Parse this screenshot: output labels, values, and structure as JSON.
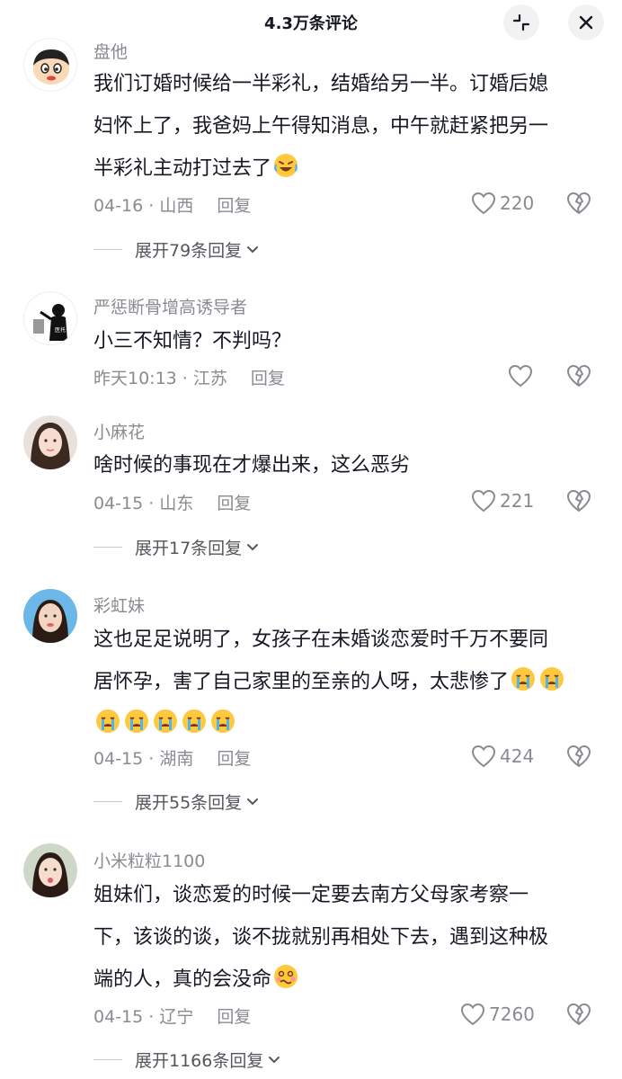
{
  "header": {
    "title": "4.3万条评论",
    "collapse_icon": "collapse-icon",
    "close_icon": "close-icon"
  },
  "comments": [
    {
      "username": "盘他",
      "lines": [
        "我们订婚时候给一半彩礼，结婚给另一半。订婚后媳",
        "妇怀上了，我爸妈上午得知消息，中午就赶紧把另一",
        "半彩礼主动打过去了"
      ],
      "emoji": [
        "laugh-cry-emoji"
      ],
      "date": "04-16",
      "location": "山西",
      "reply_label": "回复",
      "likes": "220",
      "expand": "展开79条回复"
    },
    {
      "username": "严惩断骨增高诱导者",
      "lines": [
        "小三不知情？不判吗？"
      ],
      "date": "昨天10:13",
      "location": "江苏",
      "reply_label": "回复",
      "likes": ""
    },
    {
      "username": "小麻花",
      "lines": [
        "啥时候的事现在才爆出来，这么恶劣"
      ],
      "date": "04-15",
      "location": "山东",
      "reply_label": "回复",
      "likes": "221",
      "expand": "展开17条回复"
    },
    {
      "username": "彩虹妹",
      "lines": [
        "这也足足说明了，女孩子在未婚谈恋爱时千万不要同",
        "居怀孕，害了自己家里的至亲的人呀，太悲惨了"
      ],
      "emoji": [
        "crying-emoji",
        "crying-emoji",
        "crying-emoji",
        "crying-emoji",
        "crying-emoji",
        "crying-emoji",
        "crying-emoji"
      ],
      "date": "04-15",
      "location": "湖南",
      "reply_label": "回复",
      "likes": "424",
      "expand": "展开55条回复"
    },
    {
      "username": "小米粒粒1100",
      "lines": [
        "姐妹们，谈恋爱的时候一定要去南方父母家考察一",
        "下，该谈的谈，谈不拢就别再相处下去，遇到这种极",
        "端的人，真的会没命"
      ],
      "emoji": [
        "woozy-emoji"
      ],
      "date": "04-15",
      "location": "辽宁",
      "reply_label": "回复",
      "likes": "7260",
      "expand": "展开1166条回复"
    }
  ],
  "colors": {
    "primary_text": "#161823",
    "secondary_text": "#8a8b91",
    "expand_text": "#55565c"
  }
}
